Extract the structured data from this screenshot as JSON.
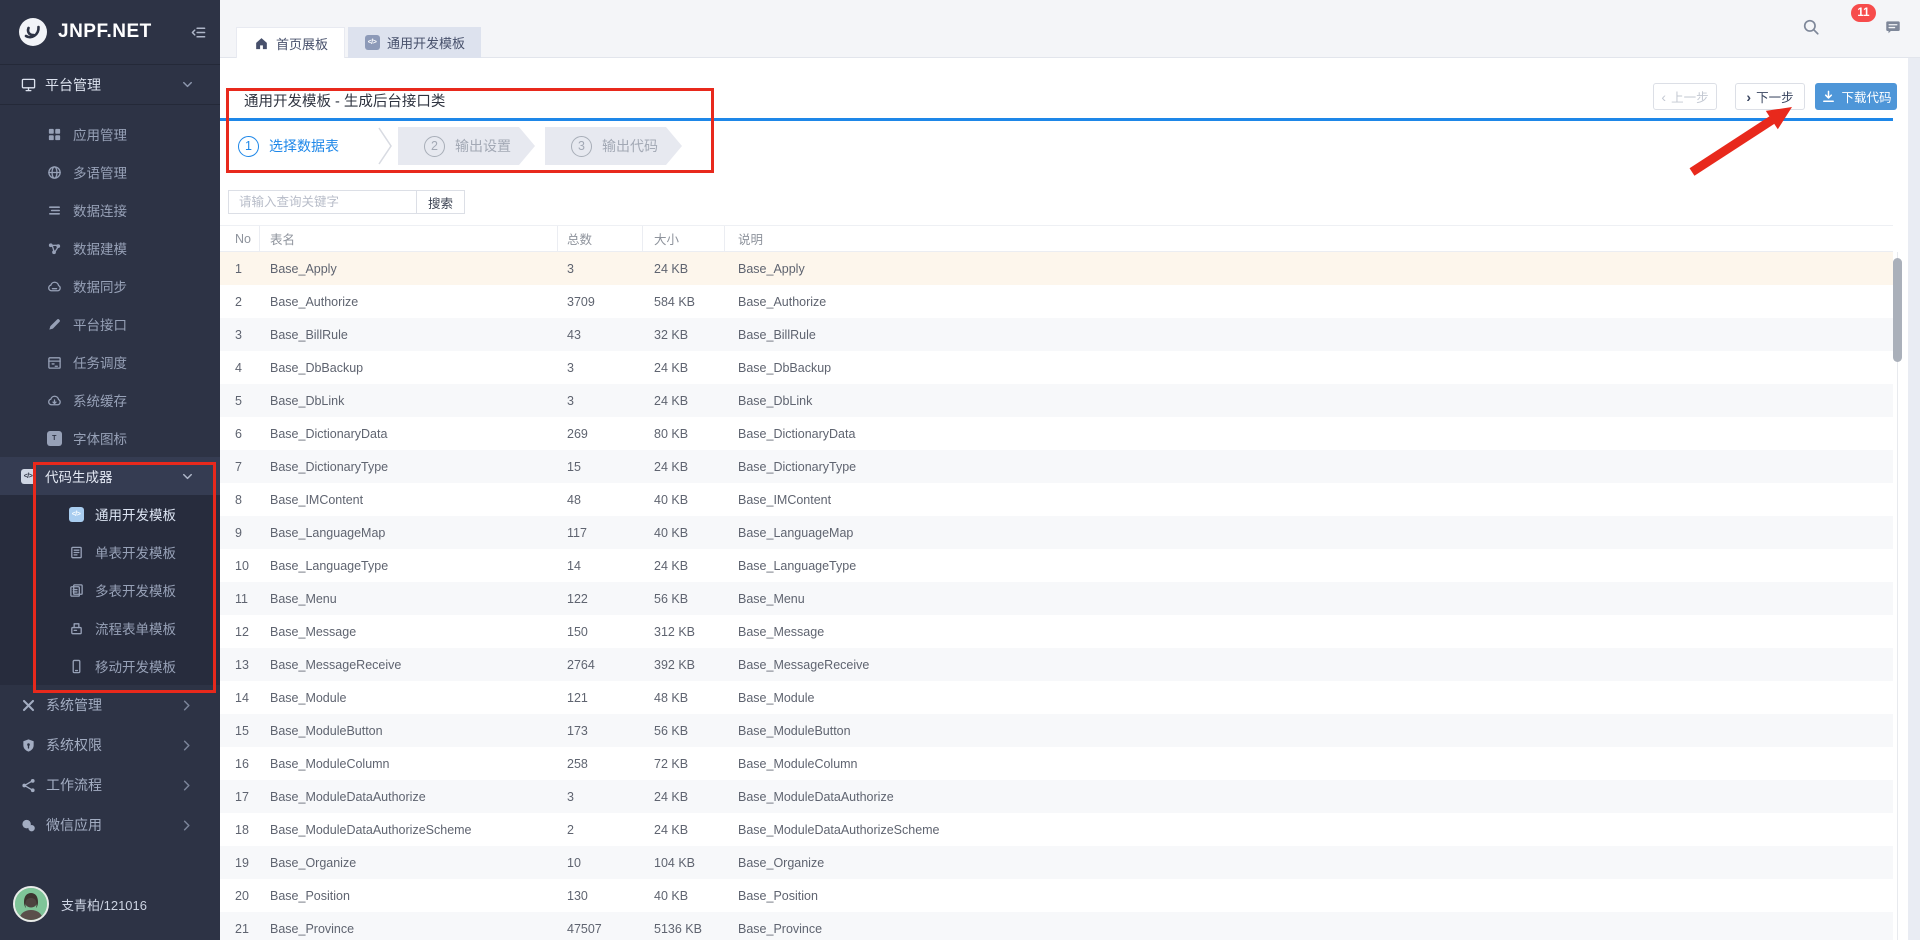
{
  "brand": {
    "logo_text": "JNPF.NET"
  },
  "topbar": {
    "tabs": [
      {
        "label": "首页展板",
        "icon": "home-icon",
        "active": false
      },
      {
        "label": "通用开发模板",
        "icon": "code-tab-icon",
        "active": true
      }
    ],
    "notification_count": "11"
  },
  "sidebar": {
    "section_label": "平台管理",
    "items": [
      {
        "label": "应用管理",
        "icon": "app-grid-icon"
      },
      {
        "label": "多语管理",
        "icon": "globe-icon"
      },
      {
        "label": "数据连接",
        "icon": "data-link-icon"
      },
      {
        "label": "数据建模",
        "icon": "data-model-icon"
      },
      {
        "label": "数据同步",
        "icon": "data-sync-icon"
      },
      {
        "label": "平台接口",
        "icon": "pen-icon"
      },
      {
        "label": "任务调度",
        "icon": "schedule-icon"
      },
      {
        "label": "系统缓存",
        "icon": "cache-icon"
      },
      {
        "label": "字体图标",
        "icon": "font-icon"
      }
    ],
    "codegen": {
      "label": "代码生成器",
      "icon": "code-generator-icon",
      "children": [
        {
          "label": "通用开发模板",
          "icon": "code-icon",
          "active": true
        },
        {
          "label": "单表开发模板",
          "icon": "single-table-icon",
          "active": false
        },
        {
          "label": "多表开发模板",
          "icon": "multi-table-icon",
          "active": false
        },
        {
          "label": "流程表单模板",
          "icon": "flow-form-icon",
          "active": false
        },
        {
          "label": "移动开发模板",
          "icon": "mobile-icon",
          "active": false
        }
      ]
    },
    "bottom_items": [
      {
        "label": "系统管理",
        "icon": "wrench-icon"
      },
      {
        "label": "系统权限",
        "icon": "shield-icon"
      },
      {
        "label": "工作流程",
        "icon": "share-icon"
      },
      {
        "label": "微信应用",
        "icon": "wechat-icon"
      }
    ],
    "user": {
      "name": "支青柏/121016"
    }
  },
  "main": {
    "title": "通用开发模板 - 生成后台接口类",
    "steps": [
      {
        "num": "1",
        "label": "选择数据表",
        "state": "active"
      },
      {
        "num": "2",
        "label": "输出设置",
        "state": "pending"
      },
      {
        "num": "3",
        "label": "输出代码",
        "state": "pending"
      }
    ],
    "buttons": {
      "prev": "上一步",
      "next": "下一步",
      "download": "下载代码"
    },
    "search": {
      "placeholder": "请输入查询关键字",
      "button": "搜索"
    },
    "table": {
      "columns": [
        "No",
        "表名",
        "总数",
        "大小",
        "说明"
      ],
      "rows": [
        [
          "1",
          "Base_Apply",
          "3",
          "24 KB",
          "Base_Apply"
        ],
        [
          "2",
          "Base_Authorize",
          "3709",
          "584 KB",
          "Base_Authorize"
        ],
        [
          "3",
          "Base_BillRule",
          "43",
          "32 KB",
          "Base_BillRule"
        ],
        [
          "4",
          "Base_DbBackup",
          "3",
          "24 KB",
          "Base_DbBackup"
        ],
        [
          "5",
          "Base_DbLink",
          "3",
          "24 KB",
          "Base_DbLink"
        ],
        [
          "6",
          "Base_DictionaryData",
          "269",
          "80 KB",
          "Base_DictionaryData"
        ],
        [
          "7",
          "Base_DictionaryType",
          "15",
          "24 KB",
          "Base_DictionaryType"
        ],
        [
          "8",
          "Base_IMContent",
          "48",
          "40 KB",
          "Base_IMContent"
        ],
        [
          "9",
          "Base_LanguageMap",
          "117",
          "40 KB",
          "Base_LanguageMap"
        ],
        [
          "10",
          "Base_LanguageType",
          "14",
          "24 KB",
          "Base_LanguageType"
        ],
        [
          "11",
          "Base_Menu",
          "122",
          "56 KB",
          "Base_Menu"
        ],
        [
          "12",
          "Base_Message",
          "150",
          "312 KB",
          "Base_Message"
        ],
        [
          "13",
          "Base_MessageReceive",
          "2764",
          "392 KB",
          "Base_MessageReceive"
        ],
        [
          "14",
          "Base_Module",
          "121",
          "48 KB",
          "Base_Module"
        ],
        [
          "15",
          "Base_ModuleButton",
          "173",
          "56 KB",
          "Base_ModuleButton"
        ],
        [
          "16",
          "Base_ModuleColumn",
          "258",
          "72 KB",
          "Base_ModuleColumn"
        ],
        [
          "17",
          "Base_ModuleDataAuthorize",
          "3",
          "24 KB",
          "Base_ModuleDataAuthorize"
        ],
        [
          "18",
          "Base_ModuleDataAuthorizeScheme",
          "2",
          "24 KB",
          "Base_ModuleDataAuthorizeScheme"
        ],
        [
          "19",
          "Base_Organize",
          "10",
          "104 KB",
          "Base_Organize"
        ],
        [
          "20",
          "Base_Position",
          "130",
          "40 KB",
          "Base_Position"
        ],
        [
          "21",
          "Base_Province",
          "47507",
          "5136 KB",
          "Base_Province"
        ]
      ],
      "selected_row_index": 0
    }
  },
  "colors": {
    "accent_blue": "#1e87e8",
    "download_button": "#4e96d8",
    "annotation_red": "#e8291c",
    "badge_red": "#f74c4c",
    "selected_row": "#fdf6ec",
    "sidebar_bg": "#2d3345"
  }
}
